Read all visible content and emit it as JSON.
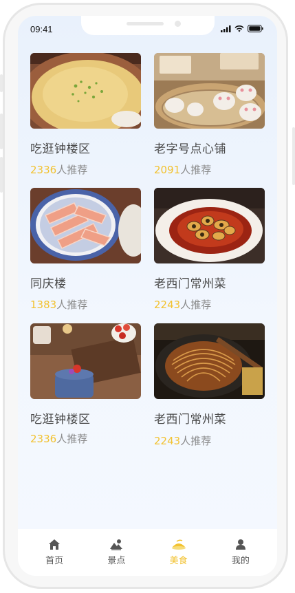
{
  "status": {
    "time": "09:41"
  },
  "cards": [
    {
      "title": "吃逛钟楼区",
      "count": "2336",
      "suffix": "人推荐",
      "photo": "congee-bowl"
    },
    {
      "title": "老字号点心铺",
      "count": "2091",
      "suffix": "人推荐",
      "photo": "steamed-buns"
    },
    {
      "title": "同庆楼",
      "count": "1383",
      "suffix": "人推荐",
      "photo": "sliced-meat-plate"
    },
    {
      "title": "老西门常州菜",
      "count": "2243",
      "suffix": "人推荐",
      "photo": "braised-dish"
    },
    {
      "title": "吃逛钟楼区",
      "count": "2336",
      "suffix": "人推荐",
      "photo": "desserts-tray"
    },
    {
      "title": "老西门常州菜",
      "count": "2243",
      "suffix": "人推荐",
      "photo": "noodles-pan"
    }
  ],
  "tabs": [
    {
      "label": "首页",
      "icon": "home-icon",
      "active": false
    },
    {
      "label": "景点",
      "icon": "scenery-icon",
      "active": false
    },
    {
      "label": "美食",
      "icon": "food-icon",
      "active": true
    },
    {
      "label": "我的",
      "icon": "user-icon",
      "active": false
    }
  ],
  "colors": {
    "accent": "#f2c230",
    "text": "#4a4a4a",
    "muted": "#8a8a8a"
  }
}
